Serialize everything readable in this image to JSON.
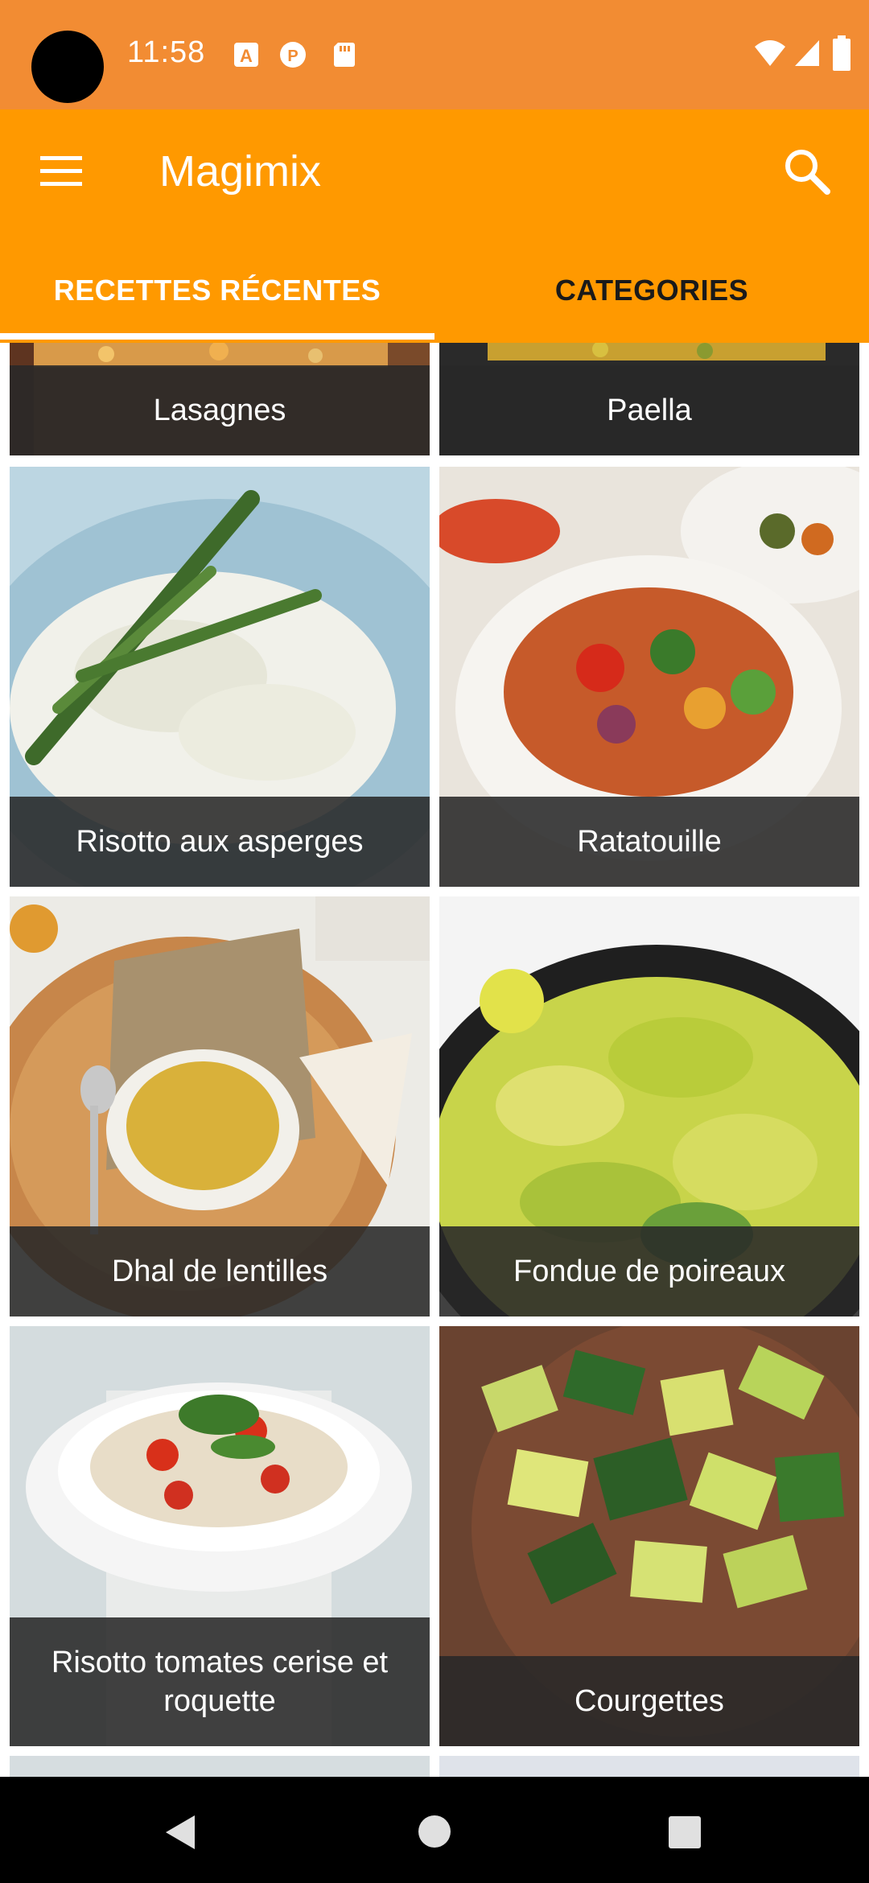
{
  "status_bar": {
    "time": "11:58",
    "notification_icons": [
      "a-icon",
      "p-icon",
      "sd-card-icon"
    ],
    "system_icons": [
      "wifi-icon",
      "signal-icon",
      "battery-icon"
    ]
  },
  "app_bar": {
    "title": "Magimix",
    "menu_icon": "hamburger-menu-icon",
    "search_icon": "search-icon"
  },
  "tabs": [
    {
      "label": "RECETTES RÉCENTES",
      "selected": true
    },
    {
      "label": "CATEGORIES",
      "selected": false
    }
  ],
  "recipes": [
    {
      "name": "Lasagnes"
    },
    {
      "name": "Paella"
    },
    {
      "name": "Risotto aux asperges"
    },
    {
      "name": "Ratatouille"
    },
    {
      "name": "Dhal de lentilles"
    },
    {
      "name": "Fondue de poireaux"
    },
    {
      "name": "Risotto tomates cerise et roquette"
    },
    {
      "name": "Courgettes"
    }
  ],
  "colors": {
    "status_bar": "#f28c33",
    "app_bar": "#ff9900",
    "caption_bg": "#282828",
    "tab_selected_text": "#ffffff",
    "tab_unselected_text": "#1a1a1a"
  },
  "nav_bar": {
    "icons": [
      "back-icon",
      "home-icon",
      "recents-icon"
    ]
  }
}
